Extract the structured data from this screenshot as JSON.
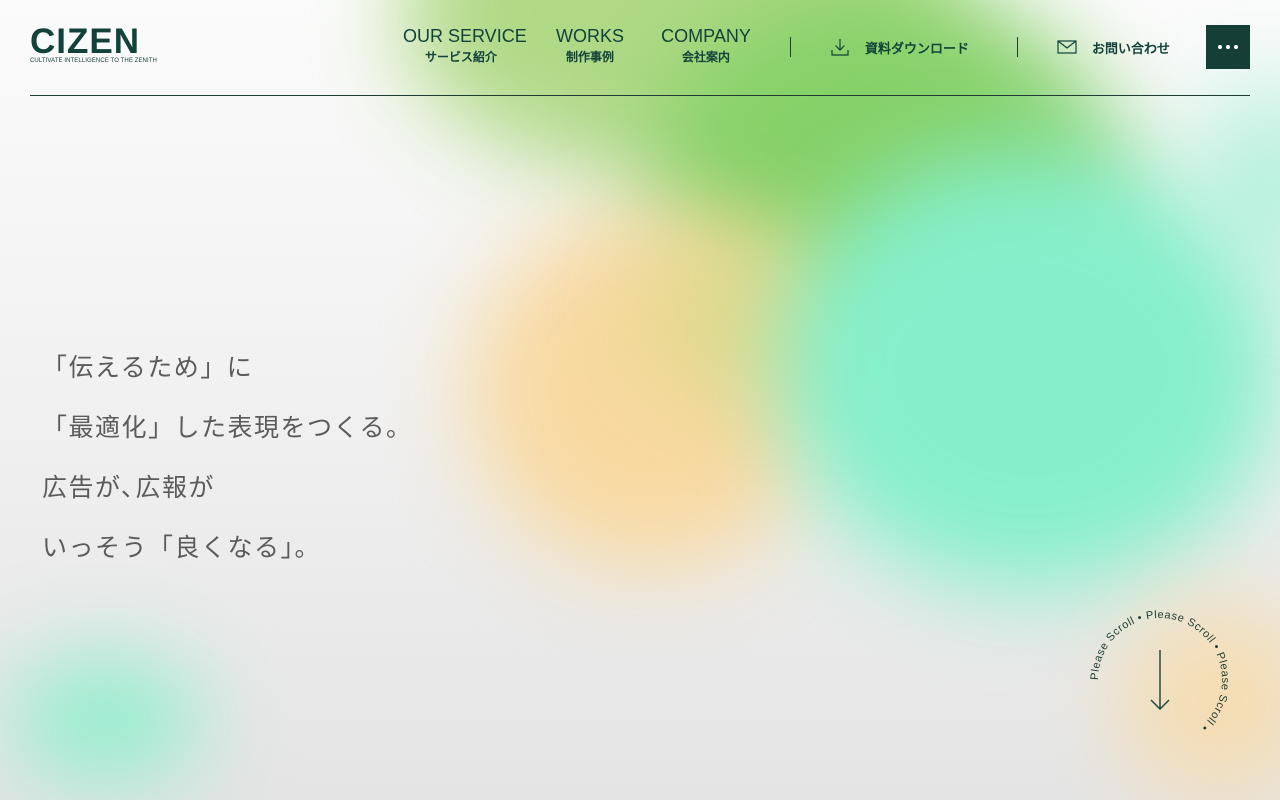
{
  "logo": {
    "wordmark": "CIZEN",
    "tagline": "CULTIVATE INTELLIGENCE TO THE ZENITH"
  },
  "nav": {
    "items": [
      {
        "en": "OUR SERVICE",
        "jp": "サービス紹介"
      },
      {
        "en": "WORKS",
        "jp": "制作事例"
      },
      {
        "en": "COMPANY",
        "jp": "会社案内"
      }
    ]
  },
  "utility": {
    "download_label": "資料ダウンロード",
    "contact_label": "お問い合わせ"
  },
  "hero": {
    "lines": [
      "「伝えるため」に",
      "「最適化」した表現をつくる。",
      "広告が､広報が",
      "いっそう「良くなる」。"
    ]
  },
  "scroll": {
    "text": "Please Scroll • Please Scroll • Please Scroll • "
  },
  "colors": {
    "brand": "#12423a",
    "menu_bg": "#153e36",
    "hero_text": "#5b5b5b"
  },
  "icons": {
    "download": "download-icon",
    "mail": "mail-icon",
    "menu": "more-dots-icon",
    "scroll": "arrow-down-icon"
  }
}
